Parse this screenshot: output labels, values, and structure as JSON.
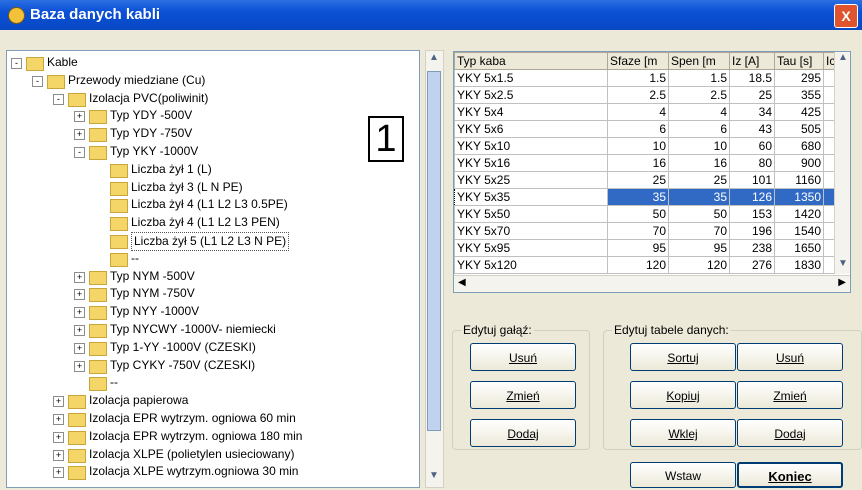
{
  "window": {
    "title": "Baza danych kabli",
    "close_label": "X"
  },
  "tree": [
    {
      "label": "Kable",
      "indent": 0,
      "expander": "-"
    },
    {
      "label": "Przewody miedziane (Cu)",
      "indent": 1,
      "expander": "-"
    },
    {
      "label": "Izolacja PVC(poliwinit)",
      "indent": 2,
      "expander": "-"
    },
    {
      "label": "Typ YDY -500V",
      "indent": 3,
      "expander": "+"
    },
    {
      "label": "Typ YDY -750V",
      "indent": 3,
      "expander": "+"
    },
    {
      "label": "Typ YKY -1000V",
      "indent": 3,
      "expander": "-"
    },
    {
      "label": "Liczba żył 1 (L)",
      "indent": 4,
      "expander": ""
    },
    {
      "label": "Liczba żył 3 (L N PE)",
      "indent": 4,
      "expander": ""
    },
    {
      "label": "Liczba żył 4 (L1 L2 L3 0.5PE)",
      "indent": 4,
      "expander": ""
    },
    {
      "label": "Liczba żył 4 (L1 L2 L3 PEN)",
      "indent": 4,
      "expander": ""
    },
    {
      "label": "Liczba żył 5 (L1 L2 L3 N PE)",
      "indent": 4,
      "expander": "",
      "selected": true
    },
    {
      "label": "--",
      "indent": 4,
      "expander": ""
    },
    {
      "label": "Typ NYM -500V",
      "indent": 3,
      "expander": "+"
    },
    {
      "label": "Typ NYM -750V",
      "indent": 3,
      "expander": "+"
    },
    {
      "label": "Typ NYY -1000V",
      "indent": 3,
      "expander": "+"
    },
    {
      "label": "Typ NYCWY -1000V- niemiecki",
      "indent": 3,
      "expander": "+"
    },
    {
      "label": "Typ 1-YY -1000V (CZESKI)",
      "indent": 3,
      "expander": "+"
    },
    {
      "label": "Typ CYKY -750V (CZESKI)",
      "indent": 3,
      "expander": "+"
    },
    {
      "label": "--",
      "indent": 3,
      "expander": ""
    },
    {
      "label": "Izolacja papierowa",
      "indent": 2,
      "expander": "+"
    },
    {
      "label": "Izolacja EPR wytrzym. ogniowa 60 min",
      "indent": 2,
      "expander": "+"
    },
    {
      "label": "Izolacja EPR wytrzym. ogniowa 180 min",
      "indent": 2,
      "expander": "+"
    },
    {
      "label": "Izolacja XLPE (polietylen usieciowany)",
      "indent": 2,
      "expander": "+"
    },
    {
      "label": "Izolacja XLPE wytrzym.ogniowa 30 min",
      "indent": 2,
      "expander": "+"
    }
  ],
  "marker": "1",
  "grid": {
    "columns": [
      "Typ kaba",
      "Sfaze [m",
      "Spen [m",
      "Iz [A]",
      "Tau [s]",
      "Ic"
    ],
    "rows": [
      [
        "YKY 5x1.5",
        "1.5",
        "1.5",
        "18.5",
        "295"
      ],
      [
        "YKY 5x2.5",
        "2.5",
        "2.5",
        "25",
        "355"
      ],
      [
        "YKY 5x4",
        "4",
        "4",
        "34",
        "425"
      ],
      [
        "YKY 5x6",
        "6",
        "6",
        "43",
        "505"
      ],
      [
        "YKY 5x10",
        "10",
        "10",
        "60",
        "680"
      ],
      [
        "YKY 5x16",
        "16",
        "16",
        "80",
        "900"
      ],
      [
        "YKY 5x25",
        "25",
        "25",
        "101",
        "1160"
      ],
      [
        "YKY 5x35",
        "35",
        "35",
        "126",
        "1350"
      ],
      [
        "YKY 5x50",
        "50",
        "50",
        "153",
        "1420"
      ],
      [
        "YKY 5x70",
        "70",
        "70",
        "196",
        "1540"
      ],
      [
        "YKY 5x95",
        "95",
        "95",
        "238",
        "1650"
      ],
      [
        "YKY 5x120",
        "120",
        "120",
        "276",
        "1830"
      ]
    ],
    "selected_row": 7
  },
  "edit_branch": {
    "legend": "Edytuj gałąź:",
    "delete": "Usuń",
    "change": "Zmień",
    "add": "Dodaj"
  },
  "edit_table": {
    "legend": "Edytuj tabele danych:",
    "sort": "Sortuj",
    "delete": "Usuń",
    "copy": "Kopiuj",
    "change": "Zmień",
    "paste": "Wklej",
    "add": "Dodaj"
  },
  "footer": {
    "insert": "Wstaw",
    "end": "Koniec"
  }
}
